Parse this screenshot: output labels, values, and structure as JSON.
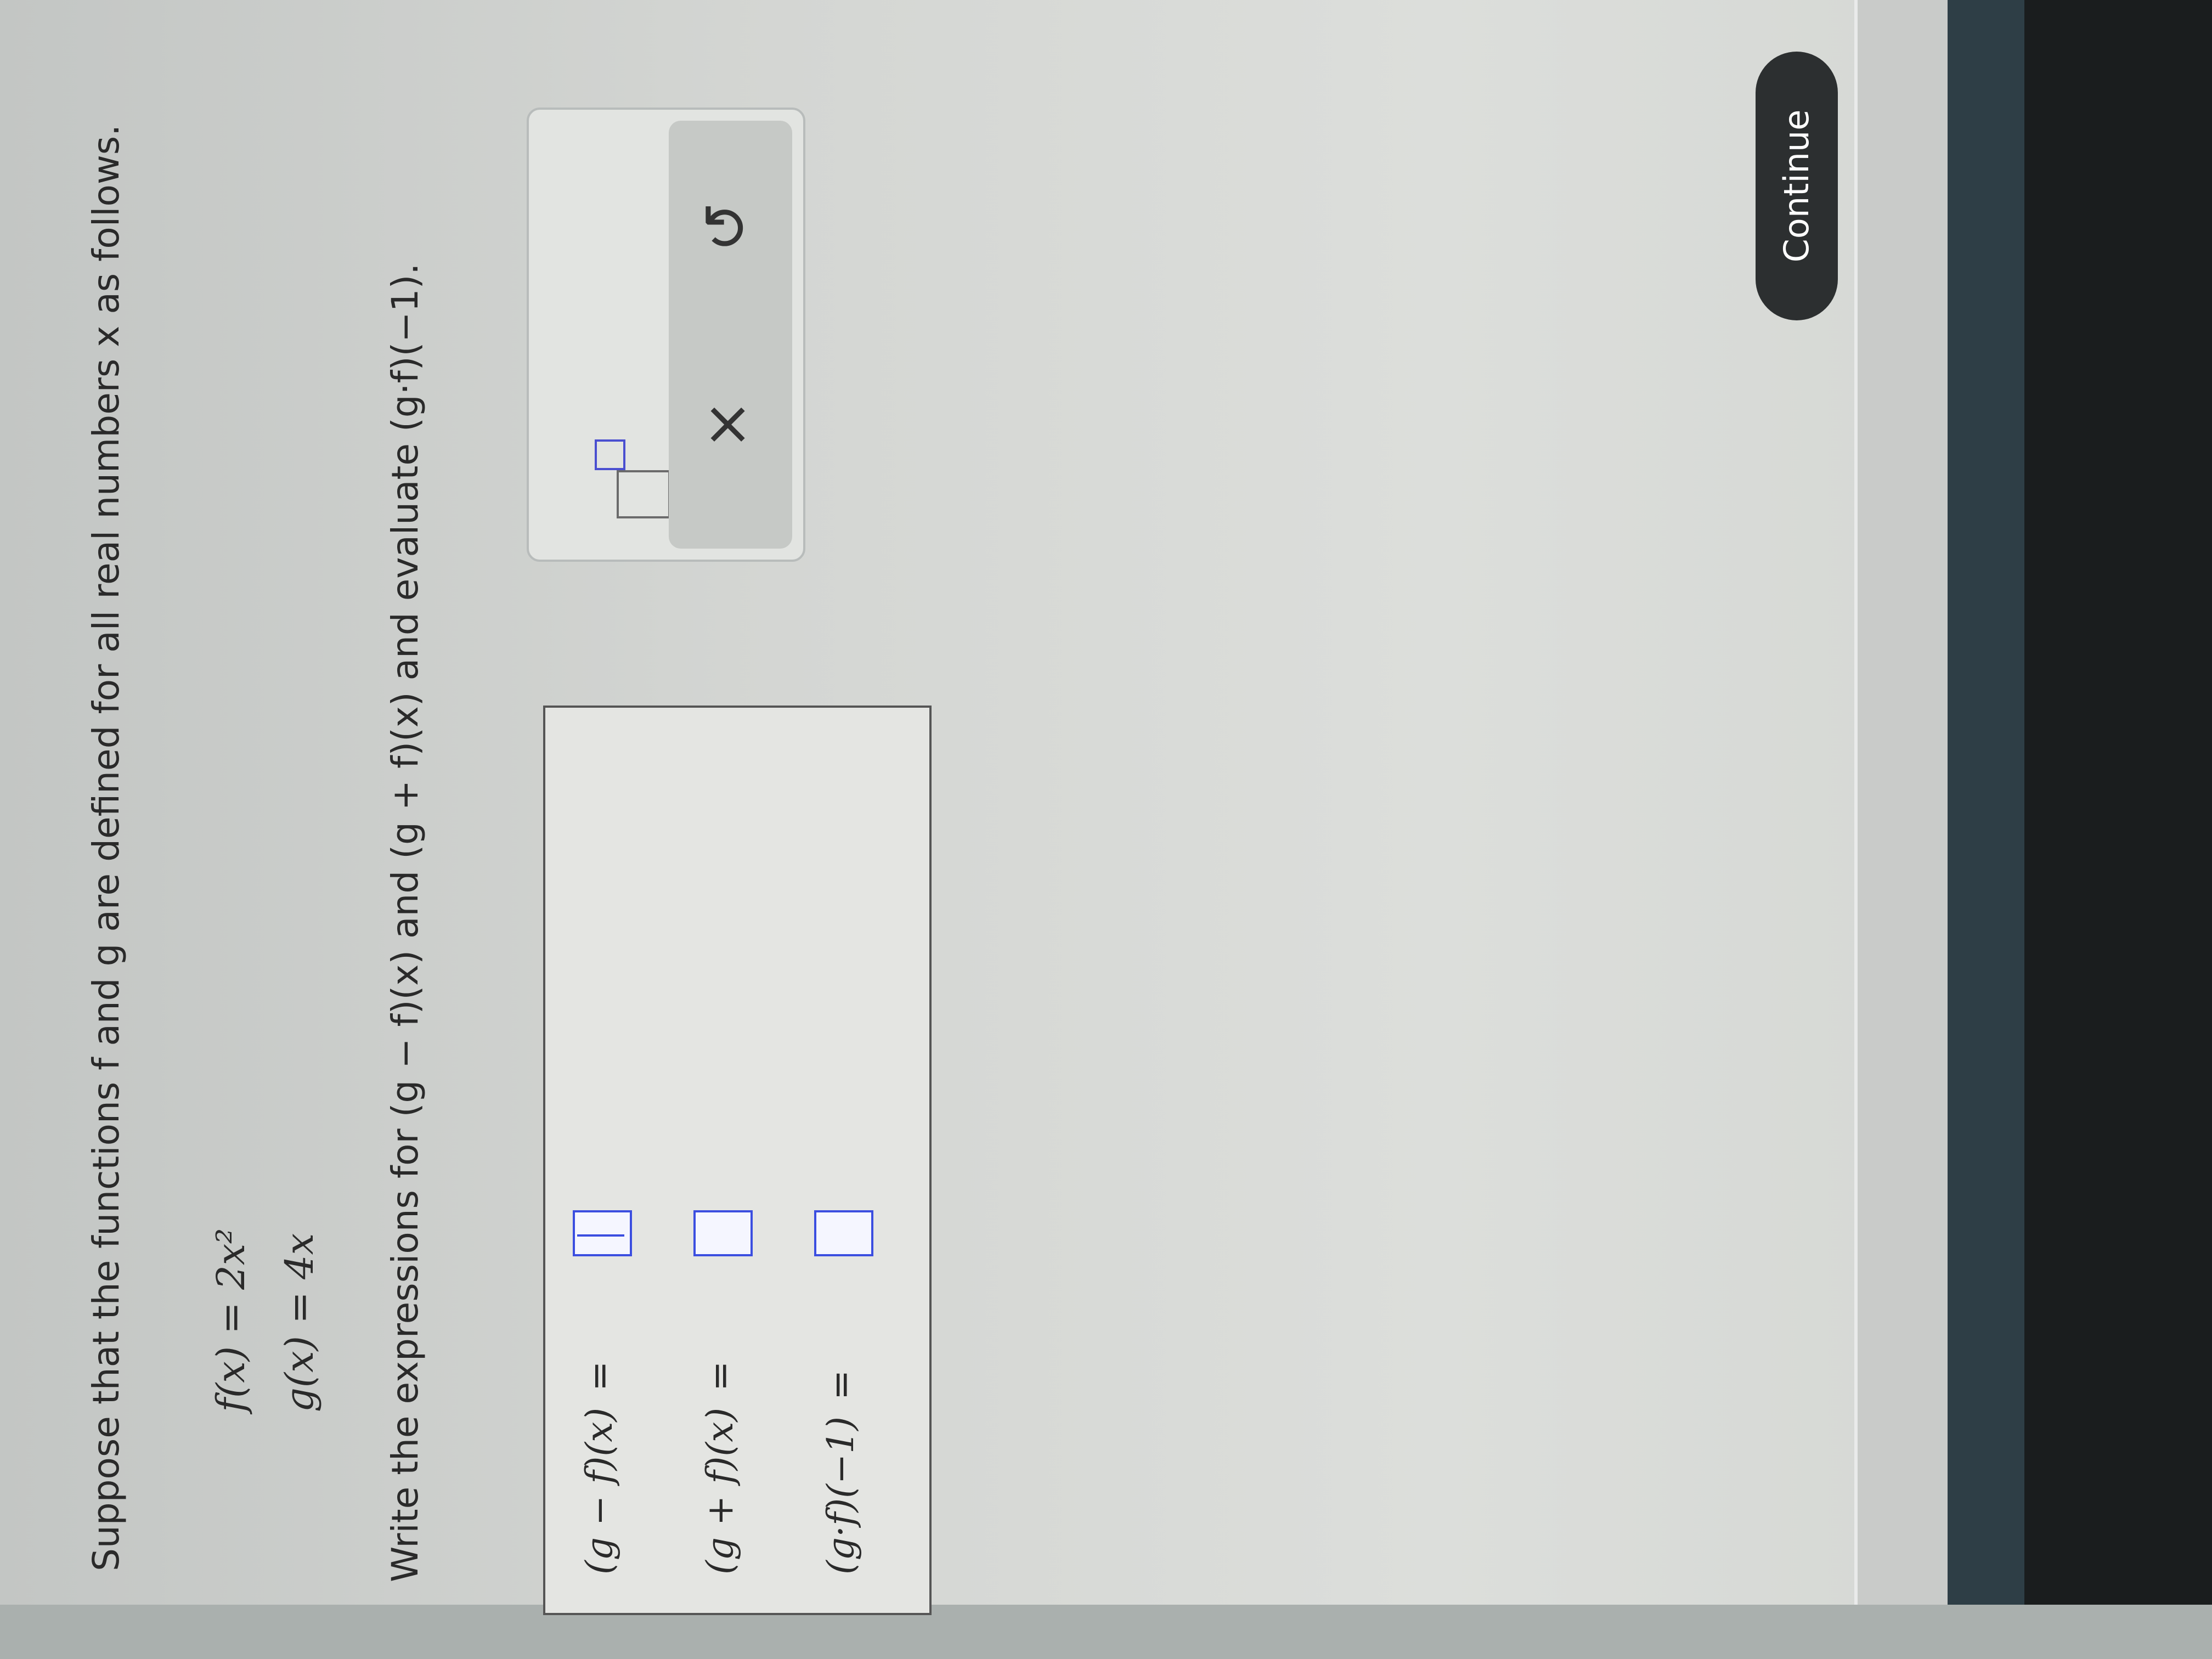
{
  "colors": {
    "accent": "#3b4ee0",
    "button_dark": "#2c2f30",
    "text": "#2a2a2a"
  },
  "question": {
    "intro": "Suppose that the functions f and g are defined for all real numbers x as follows.",
    "f_def": "f(x) = 2x²",
    "g_def": "g(x) = 4x",
    "instruction": "Write the expressions for (g − f)(x) and (g + f)(x) and evaluate (g·f)(−1)."
  },
  "answers": [
    {
      "label": "(g − f)(x)",
      "equals": "=",
      "value": ""
    },
    {
      "label": "(g + f)(x)",
      "equals": "=",
      "value": ""
    },
    {
      "label": "(g·f)(−1)",
      "equals": "=",
      "value": ""
    }
  ],
  "toolbox": {
    "superscript_icon": "superscript-template-icon",
    "clear_symbol": "×",
    "undo_symbol": "↺"
  },
  "footer": {
    "continue_label": "Continue"
  }
}
